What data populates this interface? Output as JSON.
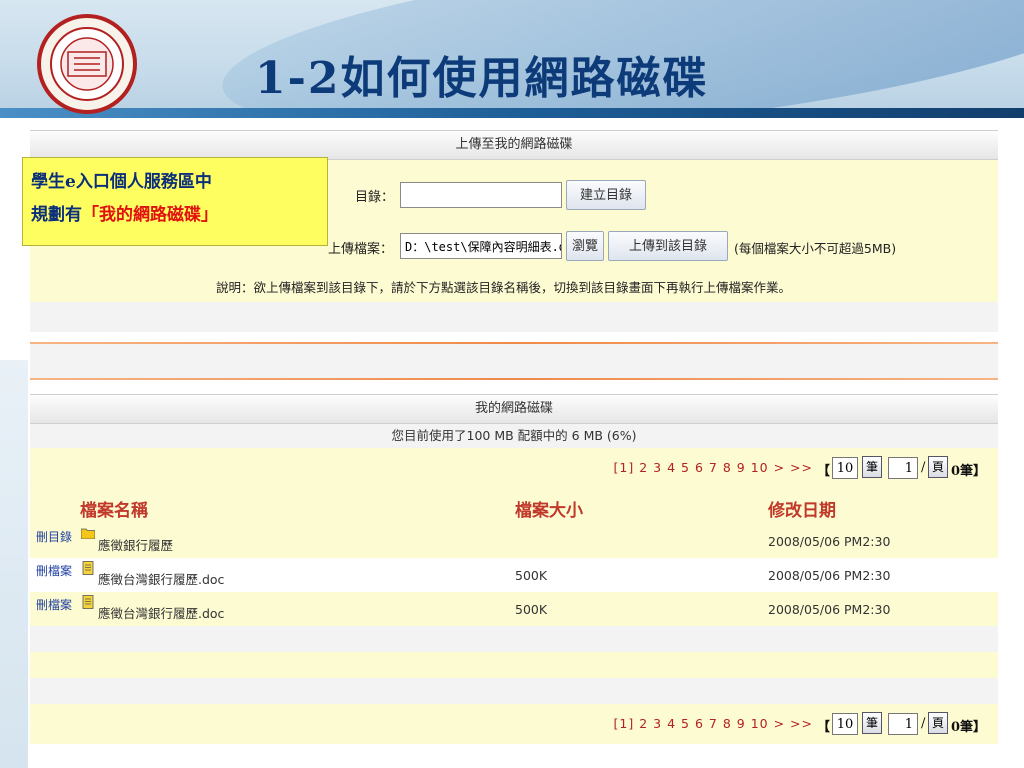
{
  "slide": {
    "title": "1-2如何使用網路磁碟",
    "logo": {
      "top_text": "人是今古 法 費天地正義",
      "ring_text": "UNTO A FULL GROWN MAN",
      "center_text": "SOOCHOW UNIVERSITY",
      "seal": "學大吳東"
    }
  },
  "callout": {
    "line1": "學生e入口個人服務區中",
    "line2_prefix": "規劃有",
    "line2_highlight": "「我的網路磁碟」"
  },
  "upload_panel": {
    "title": "上傳至我的網路磁碟",
    "directory_label": "目錄：",
    "directory_value": "",
    "create_dir_button": "建立目錄",
    "file_label": "上傳檔案：",
    "file_value": "D：\\test\\保障內容明細表.dc",
    "browse_button": "瀏覽",
    "upload_button": "上傳到該目錄",
    "size_note": "(每個檔案大小不可超過5MB)",
    "instruction": "說明：欲上傳檔案到該目錄下，請於下方點選該目錄名稱後，切換到該目錄畫面下再執行上傳檔案作業。"
  },
  "disk_panel": {
    "title": "我的網路磁碟",
    "usage_text": "您目前使用了100 MB 配額中的 6 MB (6%)",
    "pager": {
      "current": "[1]",
      "pages": [
        "2",
        "3",
        "4",
        "5",
        "6",
        "7",
        "8",
        "9",
        "10"
      ],
      "next": ">",
      "last": ">>",
      "open_bracket": "【",
      "per_page": "10",
      "per_page_btn": "筆",
      "page_input": "1",
      "slash": "/",
      "page_btn": "頁",
      "total": "0筆】"
    },
    "columns": {
      "name": "檔案名稱",
      "size": "檔案大小",
      "date": "修改日期"
    },
    "rows": [
      {
        "action": "刪目錄",
        "icon": "folder-icon",
        "name": "應徵銀行履歷",
        "size": "",
        "date": "2008/05/06 PM2:30"
      },
      {
        "action": "刪檔案",
        "icon": "document-icon",
        "name": "應徵台灣銀行履歷.doc",
        "size": "500K",
        "date": "2008/05/06 PM2:30"
      },
      {
        "action": "刪檔案",
        "icon": "document-icon",
        "name": "應徵台灣銀行履歷.doc",
        "size": "500K",
        "date": "2008/05/06 PM2:30"
      }
    ]
  },
  "colors": {
    "title": "#0d3a78",
    "callout_bg": "#fffe60",
    "pager_red": "#b22222",
    "header_red": "#c0392b",
    "panel_yellow": "#fdfbd2"
  }
}
